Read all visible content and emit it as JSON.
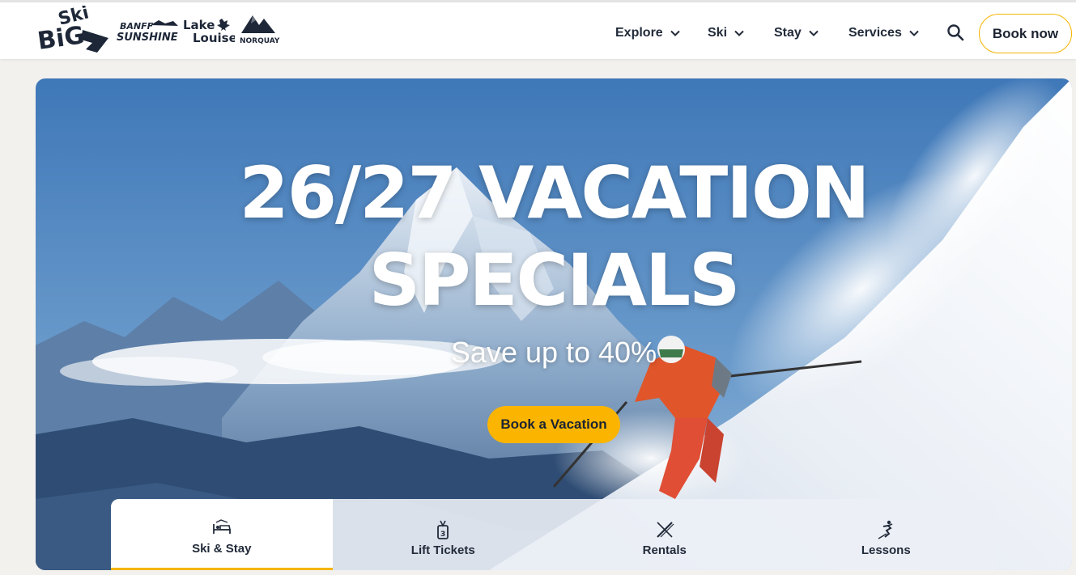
{
  "header": {
    "logos": {
      "skibig3": "Ski Big 3",
      "banff_line1": "BANFF",
      "banff_line2": "SUNSHINE",
      "lake_line1": "Lake",
      "lake_line2": "Louise",
      "norquay": "NORQUAY"
    },
    "nav": [
      {
        "label": "Explore",
        "icon": "chevron-down-icon"
      },
      {
        "label": "Ski",
        "icon": "chevron-down-icon"
      },
      {
        "label": "Stay",
        "icon": "chevron-down-icon"
      },
      {
        "label": "Services",
        "icon": "chevron-down-icon"
      }
    ],
    "search_icon": "search-icon",
    "book_now_label": "Book now"
  },
  "hero": {
    "title_line1": "26/27 VACATION",
    "title_line2": "SPECIALS",
    "subtitle": "Save up to 40%",
    "cta_label": "Book a Vacation"
  },
  "tabs": [
    {
      "label": "Ski & Stay",
      "icon": "bed-icon",
      "active": true
    },
    {
      "label": "Lift Tickets",
      "icon": "lift-ticket-icon",
      "active": false
    },
    {
      "label": "Rentals",
      "icon": "skis-icon",
      "active": false
    },
    {
      "label": "Lessons",
      "icon": "skier-icon",
      "active": false
    }
  ],
  "colors": {
    "accent": "#fbb500",
    "text": "#1c2432",
    "header_bg": "#ffffff",
    "page_bg": "#f2f1ee"
  }
}
